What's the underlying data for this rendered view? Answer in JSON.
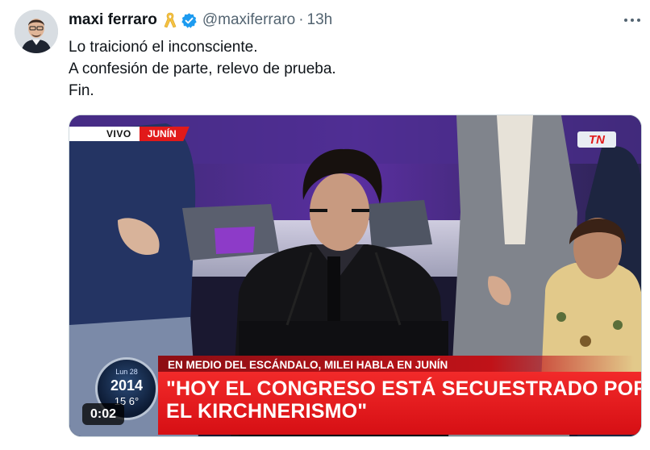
{
  "tweet": {
    "author_name": "maxi ferraro",
    "handle": "@maxiferraro",
    "separator": "·",
    "time": "13h",
    "lines": [
      "Lo traicionó el inconsciente.",
      "A confesión de parte, relevo de prueba.",
      "Fin."
    ]
  },
  "video": {
    "live_label": "VIVO",
    "location_label": "JUNÍN",
    "channel_logo": "TN",
    "chyron_top": "EN MEDIO DEL ESCÁNDALO, MILEI HABLA EN JUNÍN",
    "chyron_main": [
      "\"HOY EL CONGRESO ESTÁ SECUESTRADO POR",
      "EL KIRCHNERISMO\""
    ],
    "clock_day": "Lun 28",
    "clock_time": "2014",
    "clock_temp": "15 6°",
    "timer": "0:02"
  },
  "colors": {
    "accent_blue": "#1d9bf0",
    "ribbon_yellow": "#f5c242",
    "text_secondary": "#536471",
    "chyron_red": "#e11a1a"
  },
  "icons": {
    "ribbon": "yellow-ribbon-icon",
    "verified": "verified-badge-icon",
    "more": "more-options-icon"
  }
}
